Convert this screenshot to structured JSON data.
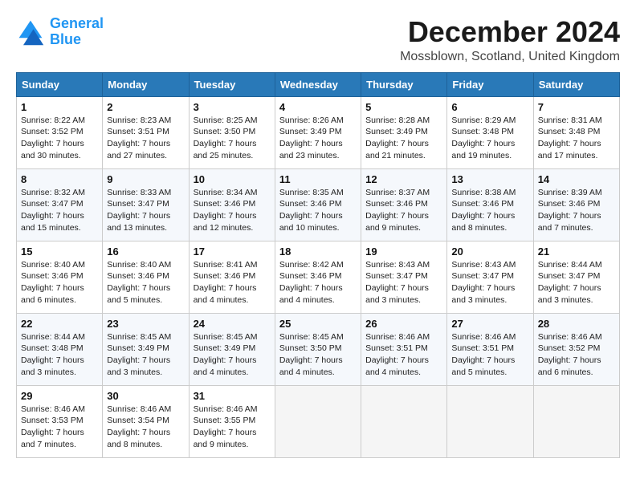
{
  "header": {
    "logo_line1": "General",
    "logo_line2": "Blue",
    "month_title": "December 2024",
    "location": "Mossblown, Scotland, United Kingdom"
  },
  "days_of_week": [
    "Sunday",
    "Monday",
    "Tuesday",
    "Wednesday",
    "Thursday",
    "Friday",
    "Saturday"
  ],
  "weeks": [
    [
      {
        "day": 1,
        "info": "Sunrise: 8:22 AM\nSunset: 3:52 PM\nDaylight: 7 hours\nand 30 minutes."
      },
      {
        "day": 2,
        "info": "Sunrise: 8:23 AM\nSunset: 3:51 PM\nDaylight: 7 hours\nand 27 minutes."
      },
      {
        "day": 3,
        "info": "Sunrise: 8:25 AM\nSunset: 3:50 PM\nDaylight: 7 hours\nand 25 minutes."
      },
      {
        "day": 4,
        "info": "Sunrise: 8:26 AM\nSunset: 3:49 PM\nDaylight: 7 hours\nand 23 minutes."
      },
      {
        "day": 5,
        "info": "Sunrise: 8:28 AM\nSunset: 3:49 PM\nDaylight: 7 hours\nand 21 minutes."
      },
      {
        "day": 6,
        "info": "Sunrise: 8:29 AM\nSunset: 3:48 PM\nDaylight: 7 hours\nand 19 minutes."
      },
      {
        "day": 7,
        "info": "Sunrise: 8:31 AM\nSunset: 3:48 PM\nDaylight: 7 hours\nand 17 minutes."
      }
    ],
    [
      {
        "day": 8,
        "info": "Sunrise: 8:32 AM\nSunset: 3:47 PM\nDaylight: 7 hours\nand 15 minutes."
      },
      {
        "day": 9,
        "info": "Sunrise: 8:33 AM\nSunset: 3:47 PM\nDaylight: 7 hours\nand 13 minutes."
      },
      {
        "day": 10,
        "info": "Sunrise: 8:34 AM\nSunset: 3:46 PM\nDaylight: 7 hours\nand 12 minutes."
      },
      {
        "day": 11,
        "info": "Sunrise: 8:35 AM\nSunset: 3:46 PM\nDaylight: 7 hours\nand 10 minutes."
      },
      {
        "day": 12,
        "info": "Sunrise: 8:37 AM\nSunset: 3:46 PM\nDaylight: 7 hours\nand 9 minutes."
      },
      {
        "day": 13,
        "info": "Sunrise: 8:38 AM\nSunset: 3:46 PM\nDaylight: 7 hours\nand 8 minutes."
      },
      {
        "day": 14,
        "info": "Sunrise: 8:39 AM\nSunset: 3:46 PM\nDaylight: 7 hours\nand 7 minutes."
      }
    ],
    [
      {
        "day": 15,
        "info": "Sunrise: 8:40 AM\nSunset: 3:46 PM\nDaylight: 7 hours\nand 6 minutes."
      },
      {
        "day": 16,
        "info": "Sunrise: 8:40 AM\nSunset: 3:46 PM\nDaylight: 7 hours\nand 5 minutes."
      },
      {
        "day": 17,
        "info": "Sunrise: 8:41 AM\nSunset: 3:46 PM\nDaylight: 7 hours\nand 4 minutes."
      },
      {
        "day": 18,
        "info": "Sunrise: 8:42 AM\nSunset: 3:46 PM\nDaylight: 7 hours\nand 4 minutes."
      },
      {
        "day": 19,
        "info": "Sunrise: 8:43 AM\nSunset: 3:47 PM\nDaylight: 7 hours\nand 3 minutes."
      },
      {
        "day": 20,
        "info": "Sunrise: 8:43 AM\nSunset: 3:47 PM\nDaylight: 7 hours\nand 3 minutes."
      },
      {
        "day": 21,
        "info": "Sunrise: 8:44 AM\nSunset: 3:47 PM\nDaylight: 7 hours\nand 3 minutes."
      }
    ],
    [
      {
        "day": 22,
        "info": "Sunrise: 8:44 AM\nSunset: 3:48 PM\nDaylight: 7 hours\nand 3 minutes."
      },
      {
        "day": 23,
        "info": "Sunrise: 8:45 AM\nSunset: 3:49 PM\nDaylight: 7 hours\nand 3 minutes."
      },
      {
        "day": 24,
        "info": "Sunrise: 8:45 AM\nSunset: 3:49 PM\nDaylight: 7 hours\nand 4 minutes."
      },
      {
        "day": 25,
        "info": "Sunrise: 8:45 AM\nSunset: 3:50 PM\nDaylight: 7 hours\nand 4 minutes."
      },
      {
        "day": 26,
        "info": "Sunrise: 8:46 AM\nSunset: 3:51 PM\nDaylight: 7 hours\nand 4 minutes."
      },
      {
        "day": 27,
        "info": "Sunrise: 8:46 AM\nSunset: 3:51 PM\nDaylight: 7 hours\nand 5 minutes."
      },
      {
        "day": 28,
        "info": "Sunrise: 8:46 AM\nSunset: 3:52 PM\nDaylight: 7 hours\nand 6 minutes."
      }
    ],
    [
      {
        "day": 29,
        "info": "Sunrise: 8:46 AM\nSunset: 3:53 PM\nDaylight: 7 hours\nand 7 minutes."
      },
      {
        "day": 30,
        "info": "Sunrise: 8:46 AM\nSunset: 3:54 PM\nDaylight: 7 hours\nand 8 minutes."
      },
      {
        "day": 31,
        "info": "Sunrise: 8:46 AM\nSunset: 3:55 PM\nDaylight: 7 hours\nand 9 minutes."
      },
      null,
      null,
      null,
      null
    ]
  ]
}
